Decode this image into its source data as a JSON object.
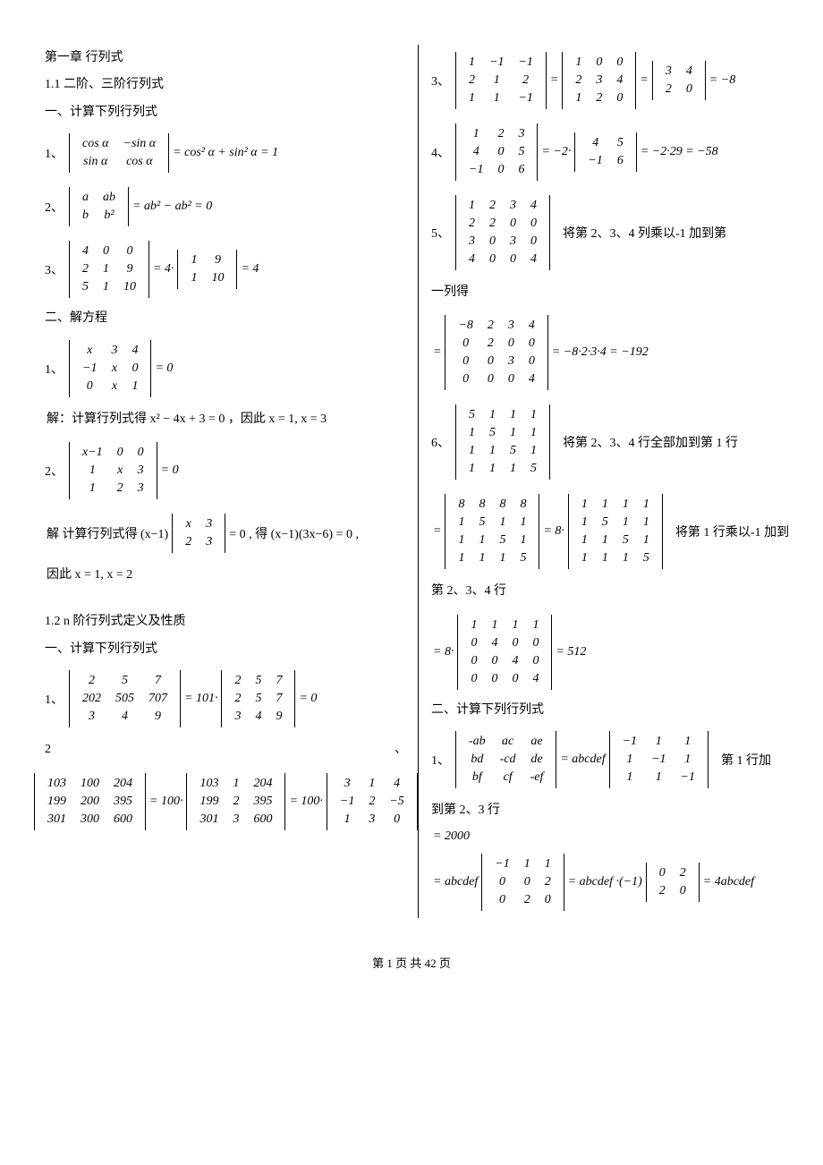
{
  "left": {
    "h1": "第一章 行列式",
    "s11": "1.1 二阶、三阶行列式",
    "t1": "一、计算下列行列式",
    "p1_num": "1、",
    "p1_m": [
      [
        "cos α",
        "−sin α"
      ],
      [
        "sin α",
        "cos α"
      ]
    ],
    "p1_rhs": "= cos² α + sin² α = 1",
    "p2_num": "2、",
    "p2_m": [
      [
        "a",
        "ab"
      ],
      [
        "b",
        "b²"
      ]
    ],
    "p2_rhs": "= ab² − ab² = 0",
    "p3_num": "3、",
    "p3_m": [
      [
        "4",
        "0",
        "0"
      ],
      [
        "2",
        "1",
        "9"
      ],
      [
        "5",
        "1",
        "10"
      ]
    ],
    "p3_mid": "= 4·",
    "p3_m2": [
      [
        "1",
        "9"
      ],
      [
        "1",
        "10"
      ]
    ],
    "p3_rhs": "= 4",
    "t2": "二、解方程",
    "e1_num": "1、",
    "e1_m": [
      [
        "x",
        "3",
        "4"
      ],
      [
        "−1",
        "x",
        "0"
      ],
      [
        "0",
        "x",
        "1"
      ]
    ],
    "e1_rhs": "= 0",
    "e1_sol": "解：计算行列式得 x² − 4x + 3 = 0 ，因此 x = 1, x = 3",
    "e2_num": "2、",
    "e2_m": [
      [
        "x−1",
        "0",
        "0"
      ],
      [
        "1",
        "x",
        "3"
      ],
      [
        "1",
        "2",
        "3"
      ]
    ],
    "e2_rhs": "= 0",
    "e2_sol_a": "解 计算行列式得 (x−1)",
    "e2_sol_m": [
      [
        "x",
        "3"
      ],
      [
        "2",
        "3"
      ]
    ],
    "e2_sol_b": "= 0 , 得 (x−1)(3x−6) = 0 ,",
    "e2_sol_c": "因此 x = 1, x = 2",
    "s12": "1.2  n 阶行列式定义及性质",
    "t3": "一、计算下列行列式",
    "q1_num": "1、",
    "q1_m": [
      [
        "2",
        "5",
        "7"
      ],
      [
        "202",
        "505",
        "707"
      ],
      [
        "3",
        "4",
        "9"
      ]
    ],
    "q1_mid": "= 101·",
    "q1_m2": [
      [
        "2",
        "5",
        "7"
      ],
      [
        "2",
        "5",
        "7"
      ],
      [
        "3",
        "4",
        "9"
      ]
    ],
    "q1_rhs": "= 0",
    "q2_num_a": "2",
    "q2_num_b": "、",
    "q2_m": [
      [
        "103",
        "100",
        "204"
      ],
      [
        "199",
        "200",
        "395"
      ],
      [
        "301",
        "300",
        "600"
      ]
    ],
    "q2_mid1": "= 100·",
    "q2_m2": [
      [
        "103",
        "1",
        "204"
      ],
      [
        "199",
        "2",
        "395"
      ],
      [
        "301",
        "3",
        "600"
      ]
    ],
    "q2_mid2": "= 100·",
    "q2_m3": [
      [
        "3",
        "1",
        "4"
      ],
      [
        "−1",
        "2",
        "−5"
      ],
      [
        "1",
        "3",
        "0"
      ]
    ]
  },
  "right": {
    "p3_num": "3、",
    "p3_m": [
      [
        "1",
        "−1",
        "−1"
      ],
      [
        "2",
        "1",
        "2"
      ],
      [
        "1",
        "1",
        "−1"
      ]
    ],
    "p3_eq1": "=",
    "p3_m2": [
      [
        "1",
        "0",
        "0"
      ],
      [
        "2",
        "3",
        "4"
      ],
      [
        "1",
        "2",
        "0"
      ]
    ],
    "p3_eq2": "=",
    "p3_m3": [
      [
        "3",
        "4"
      ],
      [
        "2",
        "0"
      ]
    ],
    "p3_rhs": "= −8",
    "p4_num": "4、",
    "p4_m": [
      [
        "1",
        "2",
        "3"
      ],
      [
        "4",
        "0",
        "5"
      ],
      [
        "−1",
        "0",
        "6"
      ]
    ],
    "p4_mid": "= −2·",
    "p4_m2": [
      [
        "4",
        "5"
      ],
      [
        "−1",
        "6"
      ]
    ],
    "p4_rhs": "= −2·29 = −58",
    "p5_num": "5、",
    "p5_m": [
      [
        "1",
        "2",
        "3",
        "4"
      ],
      [
        "2",
        "2",
        "0",
        "0"
      ],
      [
        "3",
        "0",
        "3",
        "0"
      ],
      [
        "4",
        "0",
        "0",
        "4"
      ]
    ],
    "p5_note": "将第 2、3、4 列乘以-1 加到第",
    "p5_note2": "一列得",
    "p5_b_pre": "=",
    "p5_b_m": [
      [
        "−8",
        "2",
        "3",
        "4"
      ],
      [
        "0",
        "2",
        "0",
        "0"
      ],
      [
        "0",
        "0",
        "3",
        "0"
      ],
      [
        "0",
        "0",
        "0",
        "4"
      ]
    ],
    "p5_b_rhs": "= −8·2·3·4 = −192",
    "p6_num": "6、",
    "p6_m": [
      [
        "5",
        "1",
        "1",
        "1"
      ],
      [
        "1",
        "5",
        "1",
        "1"
      ],
      [
        "1",
        "1",
        "5",
        "1"
      ],
      [
        "1",
        "1",
        "1",
        "5"
      ]
    ],
    "p6_note": "将第 2、3、4 行全部加到第 1 行",
    "p6_b_pre": "=",
    "p6_b_m": [
      [
        "8",
        "8",
        "8",
        "8"
      ],
      [
        "1",
        "5",
        "1",
        "1"
      ],
      [
        "1",
        "1",
        "5",
        "1"
      ],
      [
        "1",
        "1",
        "1",
        "5"
      ]
    ],
    "p6_b_mid": "= 8·",
    "p6_b_m2": [
      [
        "1",
        "1",
        "1",
        "1"
      ],
      [
        "1",
        "5",
        "1",
        "1"
      ],
      [
        "1",
        "1",
        "5",
        "1"
      ],
      [
        "1",
        "1",
        "1",
        "5"
      ]
    ],
    "p6_b_note": "将第 1 行乘以-1 加到",
    "p6_b_note2": "第 2、3、4 行",
    "p6_c_pre": "= 8·",
    "p6_c_m": [
      [
        "1",
        "1",
        "1",
        "1"
      ],
      [
        "0",
        "4",
        "0",
        "0"
      ],
      [
        "0",
        "0",
        "4",
        "0"
      ],
      [
        "0",
        "0",
        "0",
        "4"
      ]
    ],
    "p6_c_rhs": "= 512",
    "t2": "二、计算下列行列式",
    "r1_num": "1、",
    "r1_m": [
      [
        "-ab",
        "ac",
        "ae"
      ],
      [
        "bd",
        "-cd",
        "de"
      ],
      [
        "bf",
        "cf",
        "-ef"
      ]
    ],
    "r1_mid": "= abcdef",
    "r1_m2": [
      [
        "−1",
        "1",
        "1"
      ],
      [
        "1",
        "−1",
        "1"
      ],
      [
        "1",
        "1",
        "−1"
      ]
    ],
    "r1_note": "第 1 行加",
    "r1_note2": "到第 2、3 行",
    "r1_b_eq": "= 2000",
    "r1_c_pre": "= abcdef",
    "r1_c_m": [
      [
        "−1",
        "1",
        "1"
      ],
      [
        "0",
        "0",
        "2"
      ],
      [
        "0",
        "2",
        "0"
      ]
    ],
    "r1_c_mid": "= abcdef ·(−1)",
    "r1_c_m2": [
      [
        "0",
        "2"
      ],
      [
        "2",
        "0"
      ]
    ],
    "r1_c_rhs": "= 4abcdef"
  },
  "footer": "第 1 页 共 42 页"
}
